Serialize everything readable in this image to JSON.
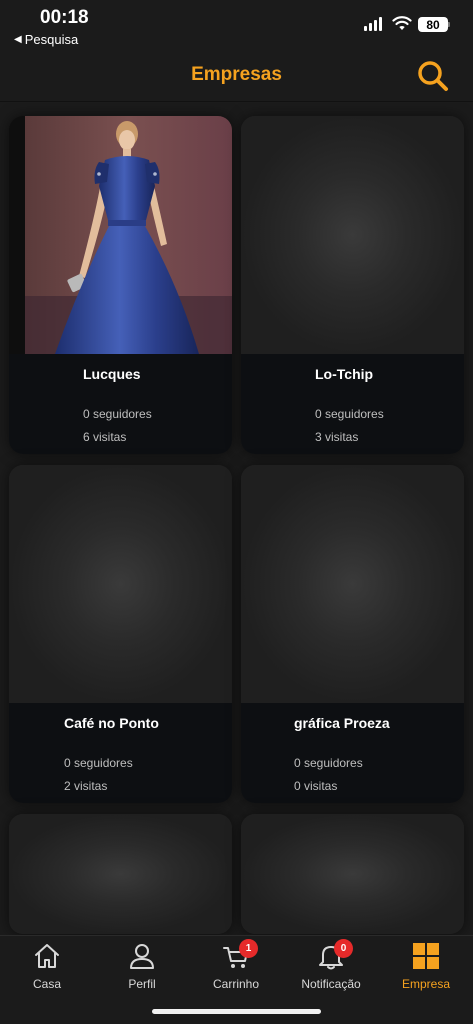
{
  "status_bar": {
    "time": "00:18",
    "back_app": "Pesquisa",
    "battery": "80"
  },
  "header": {
    "title": "Empresas",
    "search_icon": "search-icon",
    "accent_color": "#f5a21f"
  },
  "companies": [
    {
      "name": "Lucques",
      "followers": "0 seguidores",
      "visits": "6 visitas",
      "image": "dress-photo"
    },
    {
      "name": "Lo-Tchip",
      "followers": "0 seguidores",
      "visits": "3 visitas",
      "image": "placeholder"
    },
    {
      "name": "Café no Ponto",
      "followers": "0 seguidores",
      "visits": "2 visitas",
      "image": "placeholder"
    },
    {
      "name": "gráfica Proeza",
      "followers": "0 seguidores",
      "visits": "0 visitas",
      "image": "placeholder"
    }
  ],
  "tabbar": {
    "items": [
      {
        "label": "Casa",
        "icon": "home-icon"
      },
      {
        "label": "Perfil",
        "icon": "user-icon"
      },
      {
        "label": "Carrinho",
        "icon": "cart-icon",
        "badge": "1"
      },
      {
        "label": "Notificação",
        "icon": "bell-icon",
        "badge": "0"
      },
      {
        "label": "Empresa",
        "icon": "grid-icon",
        "active": true
      }
    ]
  }
}
